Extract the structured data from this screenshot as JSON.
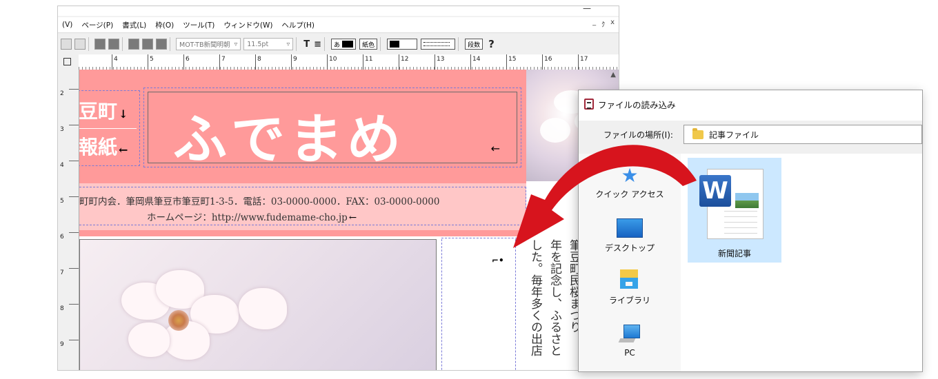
{
  "editor": {
    "menu": [
      "(V)",
      "ページ(P)",
      "書式(L)",
      "枠(O)",
      "ツール(T)",
      "ウィンドウ(W)",
      "ヘルプ(H)"
    ],
    "window_controls": [
      "_",
      "ｸ",
      "x"
    ],
    "toolbar": {
      "font_name": "MOT-TB新聞明朝",
      "font_size": "11.5pt",
      "bold_label": "T",
      "align_label": "≡",
      "text_color_label": "あ",
      "bg_color_label": "紙色",
      "columns_label": "段数",
      "help_label": "?"
    },
    "ruler_h": [
      "4",
      "5",
      "6",
      "7",
      "8",
      "9",
      "10",
      "11",
      "12",
      "13",
      "14",
      "15",
      "16",
      "17"
    ],
    "ruler_v": [
      "2",
      "3",
      "4",
      "5",
      "6",
      "7",
      "8",
      "9"
    ],
    "newsletter": {
      "left_line1": "豆町",
      "left_line2": "報紙",
      "title": "ふでまめ",
      "address_line": "町町内会．筆岡県筆豆市筆豆町1-3-5．電話：03-0000-0000．FAX：03-0000-0000",
      "homepage_line": "ホームページ：http://www.fudemame-cho.jp",
      "col1": "筆豆町民桜まつり",
      "col2": "年を記念し、ふるさと",
      "col3": "した。毎年多くの出店"
    },
    "colors": {
      "header_pink": "#ff9a9a",
      "address_pink": "#ffc7c7",
      "arrow_red": "#d7141d"
    }
  },
  "dialog": {
    "title": "ファイルの読み込み",
    "location_label": "ファイルの場所(I):",
    "location_value": "記事ファイル",
    "sidebar": [
      {
        "label": "クイック アクセス",
        "icon": "star-icon"
      },
      {
        "label": "デスクトップ",
        "icon": "desktop-icon"
      },
      {
        "label": "ライブラリ",
        "icon": "library-icon"
      },
      {
        "label": "PC",
        "icon": "pc-icon"
      }
    ],
    "file": {
      "name": "新聞記事",
      "icon": "word-document-icon",
      "badge": "W"
    }
  }
}
